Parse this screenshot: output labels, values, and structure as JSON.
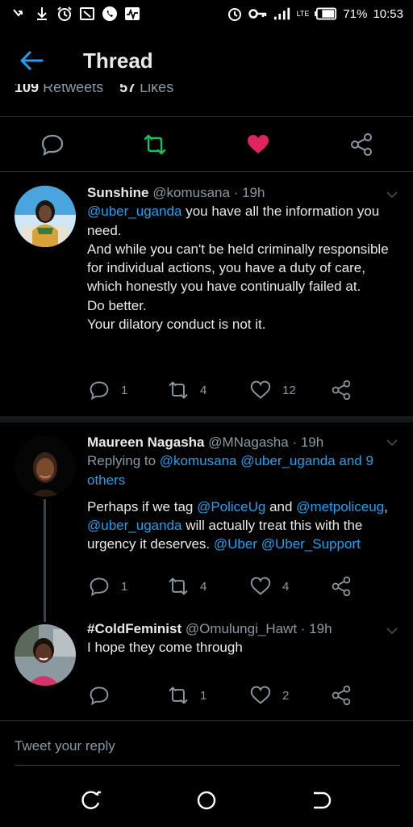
{
  "status_bar": {
    "battery": "71%",
    "time": "10:53",
    "network": "LTE",
    "icons": [
      "missed-call-icon",
      "download-icon",
      "alarm-icon",
      "screenshot-icon",
      "whatsapp-icon",
      "activity-icon",
      "alarm-icon",
      "key-icon",
      "signal-icon",
      "battery-icon"
    ]
  },
  "header": {
    "title": "Thread"
  },
  "main_tweet_stats": {
    "retweets_count": "109",
    "retweets_label": "Retweets",
    "likes_count": "57",
    "likes_label": "Likes"
  },
  "colors": {
    "accent": "#1da1f2",
    "retweet_green": "#17bf63",
    "like_red": "#e0245e",
    "muted": "#8899a6"
  },
  "tweets": [
    {
      "name": "Sunshine",
      "handle": "@komusana",
      "time": "· 19h",
      "mention": "@uber_uganda",
      "text_first": " you have all the information you need.",
      "lines": [
        "And while you can't be held criminally responsible for individual actions, you have a duty of care, which honestly you have continually failed at.",
        "Do better.",
        "Your dilatory conduct is not it."
      ],
      "replies": "1",
      "retweets": "4",
      "likes": "12"
    },
    {
      "name": "Maureen Nagasha",
      "handle": "@MNagasha",
      "time": "· 19h",
      "replying_prefix": "Replying to ",
      "replying_to": "@komusana @uber_uganda and 9 others",
      "text_1": "Perhaps if we tag ",
      "mention_1": "@PoliceUg",
      "text_2": " and ",
      "mention_2": "@metpoliceug",
      "text_3": ", ",
      "mention_3": "@uber_uganda",
      "text_4": " will actually treat this with the urgency it deserves. ",
      "mention_4": "@Uber",
      "text_5": " ",
      "mention_5": "@Uber_Support",
      "replies": "1",
      "retweets": "4",
      "likes": "4"
    },
    {
      "name": "#ColdFeminist",
      "handle": "@Omulungi_Hawt",
      "time": "· 19h",
      "text": "I hope they come through",
      "replies": "",
      "retweets": "1",
      "likes": "2"
    }
  ],
  "reply_bar": {
    "placeholder": "Tweet your reply"
  }
}
